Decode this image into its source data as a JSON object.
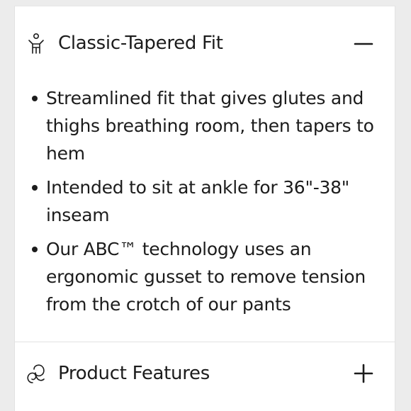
{
  "accordion": {
    "fit_section": {
      "icon": "person-icon",
      "title": "Classic-Tapered Fit",
      "toggle_icon": "minus-icon",
      "expanded": true,
      "bullets": [
        "Streamlined fit that gives glutes and thighs breathing room, then tapers to hem",
        "Intended to sit at ankle for 36\"-38\" inseam",
        "Our ABC™ technology uses an ergonomic gusset to remove tension from the crotch of our pants"
      ]
    },
    "features_section": {
      "icon": "fabric-swirl-icon",
      "title": "Product Features",
      "toggle_icon": "plus-icon",
      "expanded": false
    }
  },
  "colors": {
    "background": "#ececec",
    "panel": "#ffffff",
    "text": "#1c1c1c",
    "divider": "#e3e3e3"
  }
}
